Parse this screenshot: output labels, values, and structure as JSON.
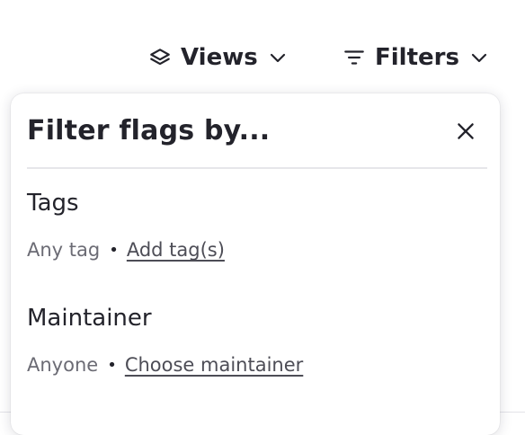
{
  "toolbar": {
    "views_label": "Views",
    "views_icon": "layers-icon",
    "filters_label": "Filters",
    "filters_icon": "filter-lines-icon",
    "dropdown_icon": "chevron-down-icon"
  },
  "panel": {
    "title": "Filter flags by...",
    "close_icon": "close-icon",
    "sections": [
      {
        "title": "Tags",
        "value": "Any tag",
        "separator": "•",
        "action": "Add tag(s)"
      },
      {
        "title": "Maintainer",
        "value": "Anyone",
        "separator": "•",
        "action": "Choose maintainer"
      }
    ]
  },
  "colors": {
    "text_primary": "#23232b",
    "text_muted": "#6b6b74",
    "divider": "#e6e6ea"
  }
}
